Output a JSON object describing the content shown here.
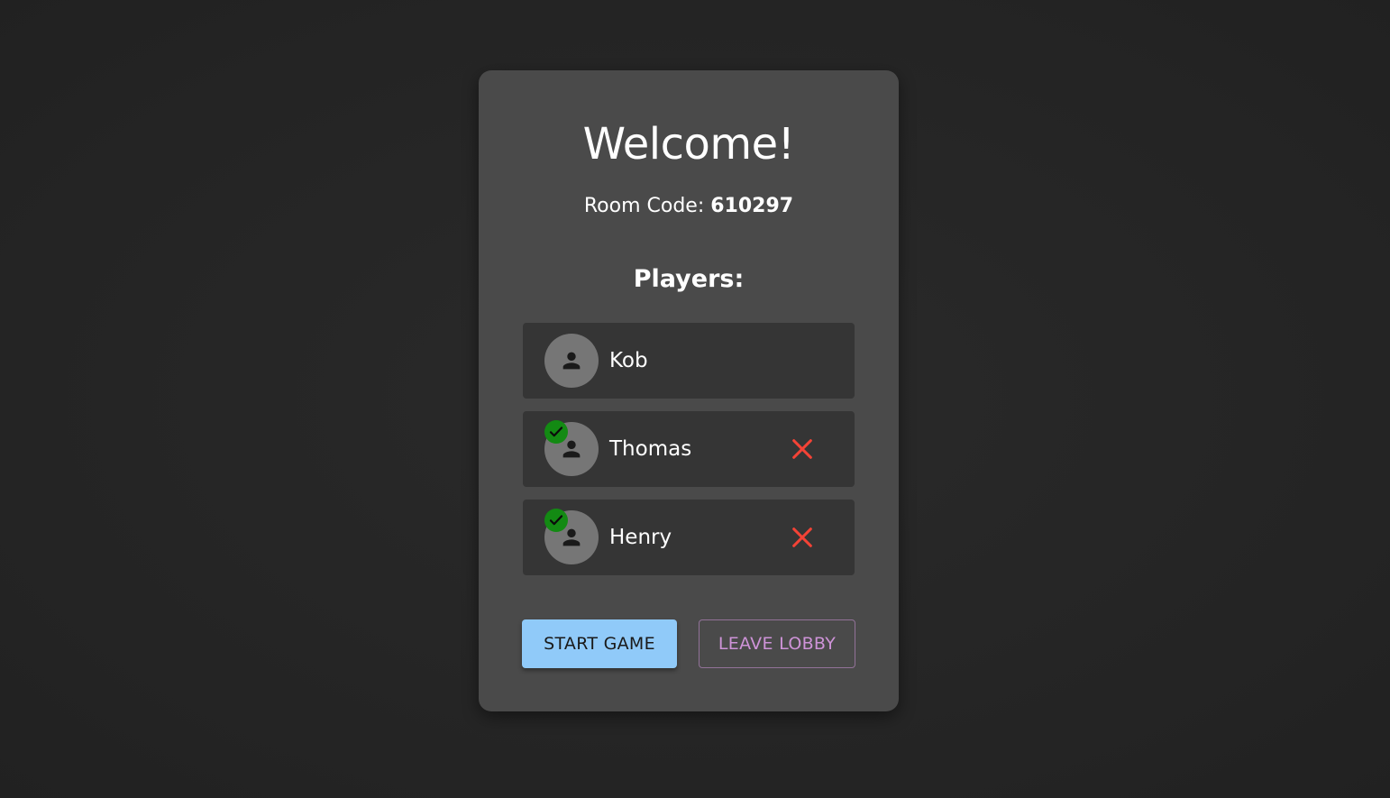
{
  "lobby": {
    "title": "Welcome!",
    "room_code_label": "Room Code: ",
    "room_code": "610297",
    "players_heading": "Players:",
    "players": [
      {
        "name": "Kob",
        "ready": false,
        "kickable": false
      },
      {
        "name": "Thomas",
        "ready": true,
        "kickable": true
      },
      {
        "name": "Henry",
        "ready": true,
        "kickable": true
      }
    ],
    "start_label": "START GAME",
    "leave_label": "LEAVE LOBBY"
  },
  "colors": {
    "background": "#242424",
    "card": "#4a4a4a",
    "player_row": "#353535",
    "avatar": "#767676",
    "ready_badge": "#138a13",
    "kick_icon": "#f44336",
    "primary_button": "#90caf9",
    "secondary_button_text": "#ce93d8"
  },
  "icons": {
    "avatar": "person-icon",
    "ready": "check-circle-icon",
    "kick": "close-icon"
  }
}
